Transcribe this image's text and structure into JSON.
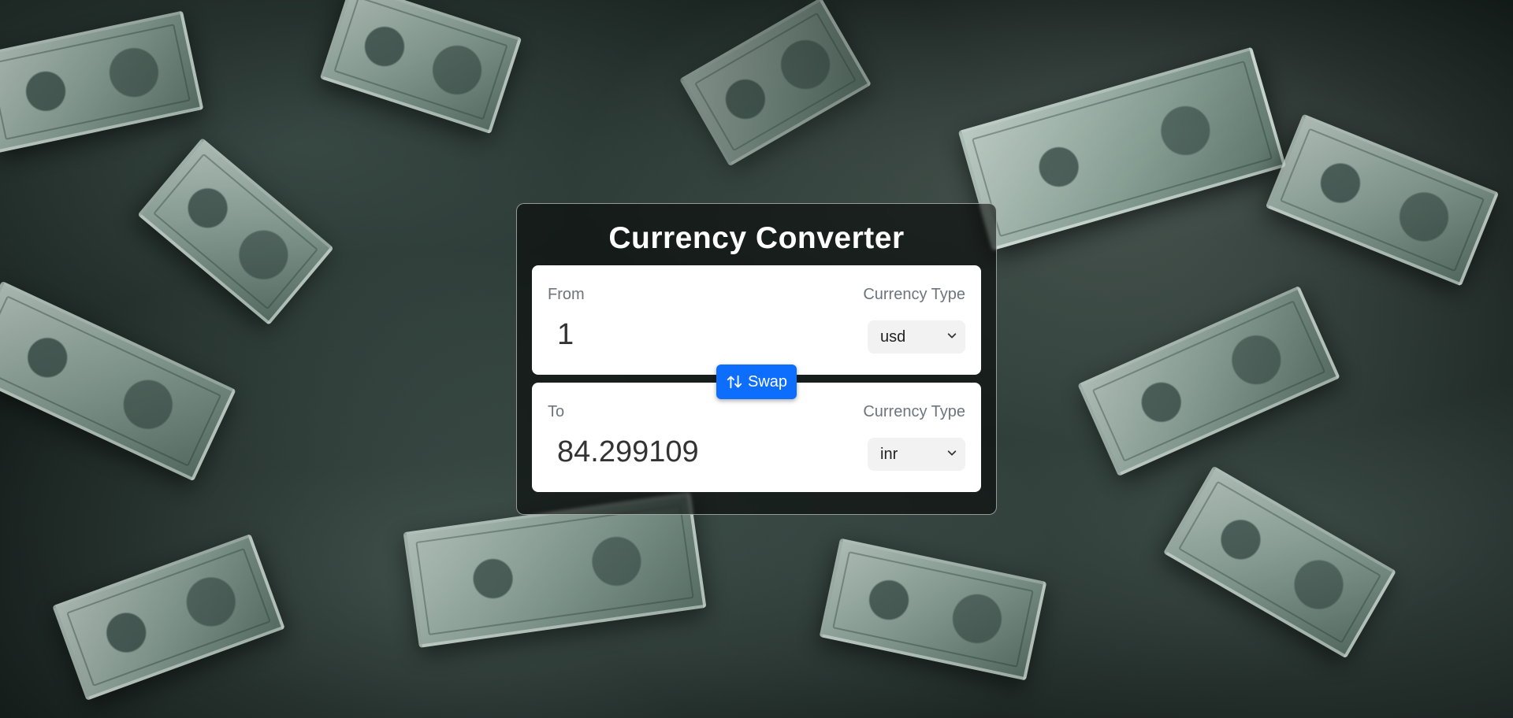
{
  "app": {
    "title": "Currency Converter"
  },
  "from": {
    "label": "From",
    "amount": "1",
    "currency_type_label": "Currency Type",
    "currency": "usd"
  },
  "swap": {
    "label": "Swap",
    "icon": "swap-vertical-arrows-icon",
    "color": "#0d6efd"
  },
  "to": {
    "label": "To",
    "amount": "84.299109",
    "currency_type_label": "Currency Type",
    "currency": "inr"
  },
  "background": {
    "theme": "scattered dollar bills"
  }
}
